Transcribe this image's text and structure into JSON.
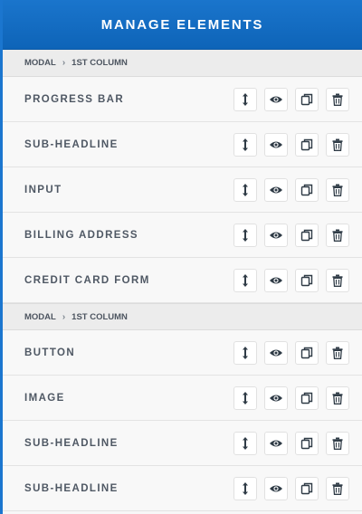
{
  "header": {
    "title": "MANAGE ELEMENTS"
  },
  "sections": [
    {
      "breadcrumb": {
        "first": "MODAL",
        "second": "1ST COLUMN"
      },
      "items": [
        {
          "label": "PROGRESS BAR"
        },
        {
          "label": "SUB-HEADLINE"
        },
        {
          "label": "INPUT"
        },
        {
          "label": "BILLING ADDRESS"
        },
        {
          "label": "CREDIT CARD FORM"
        }
      ]
    },
    {
      "breadcrumb": {
        "first": "MODAL",
        "second": "1ST COLUMN"
      },
      "items": [
        {
          "label": "BUTTON"
        },
        {
          "label": "IMAGE"
        },
        {
          "label": "SUB-HEADLINE"
        },
        {
          "label": "SUB-HEADLINE"
        }
      ]
    }
  ],
  "icons": {
    "move": "vertical-resize-icon",
    "visibility": "eye-icon",
    "duplicate": "copy-icon",
    "delete": "trash-icon"
  },
  "colors": {
    "header": "#1a75cc",
    "accent_border": "#1b76cf",
    "label": "#4f5864",
    "icon": "#2f3b46"
  }
}
